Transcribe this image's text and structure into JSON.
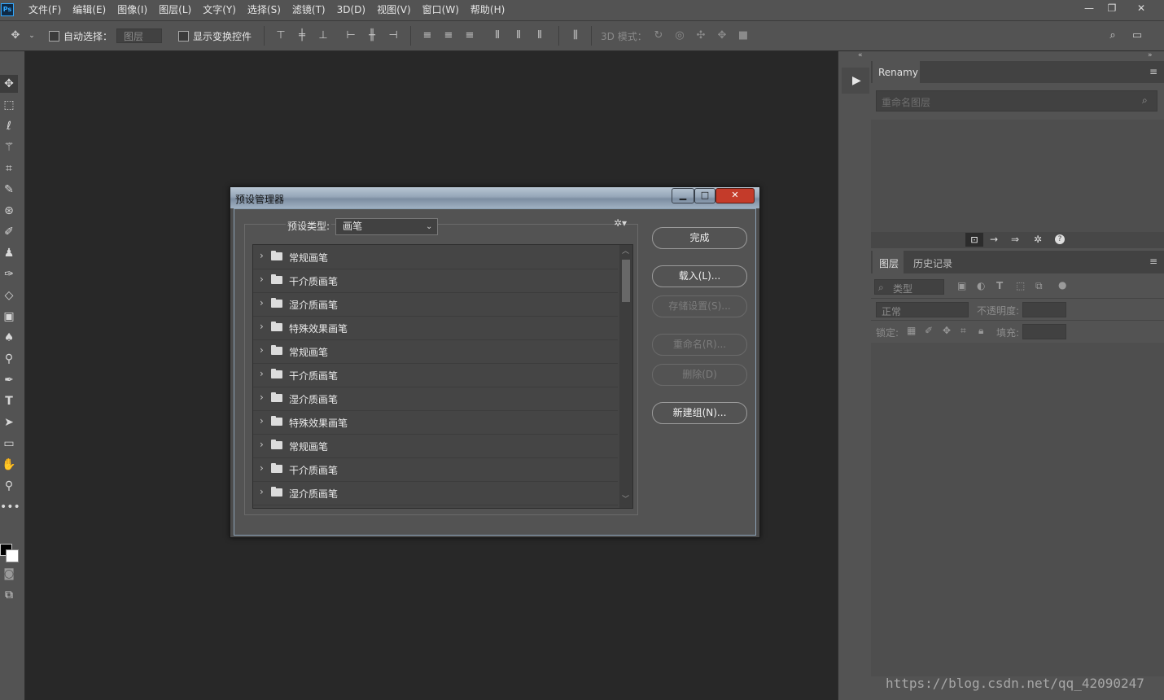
{
  "app": {
    "logo": "Ps",
    "menu": [
      "文件(F)",
      "编辑(E)",
      "图像(I)",
      "图层(L)",
      "文字(Y)",
      "选择(S)",
      "滤镜(T)",
      "3D(D)",
      "视图(V)",
      "窗口(W)",
      "帮助(H)"
    ],
    "window_controls": [
      "—",
      "❐",
      "✕"
    ]
  },
  "options_bar": {
    "auto_select_label": "自动选择：",
    "auto_select_value": "图层",
    "show_transform_label": "显示变换控件",
    "mode_3d_label": "3D 模式："
  },
  "dialog": {
    "title": "预设管理器",
    "preset_type_label": "预设类型:",
    "preset_type_value": "画笔",
    "groups": [
      "常规画笔",
      "干介质画笔",
      "湿介质画笔",
      "特殊效果画笔",
      "常规画笔",
      "干介质画笔",
      "湿介质画笔",
      "特殊效果画笔",
      "常规画笔",
      "干介质画笔",
      "湿介质画笔"
    ],
    "buttons": {
      "done": "完成",
      "load": "载入(L)...",
      "save_set": "存储设置(S)...",
      "rename": "重命名(R)...",
      "delete": "删除(D)",
      "new_group": "新建组(N)..."
    }
  },
  "renamy_panel": {
    "tab": "Renamy",
    "search_placeholder": "重命名图层"
  },
  "layers_panel": {
    "tabs": [
      "图层",
      "历史记录"
    ],
    "kind_filter": "类型",
    "blend_mode": "正常",
    "opacity_label": "不透明度:",
    "lock_label": "锁定:",
    "fill_label": "填充:"
  },
  "watermark": "https://blog.csdn.net/qq_42090247"
}
